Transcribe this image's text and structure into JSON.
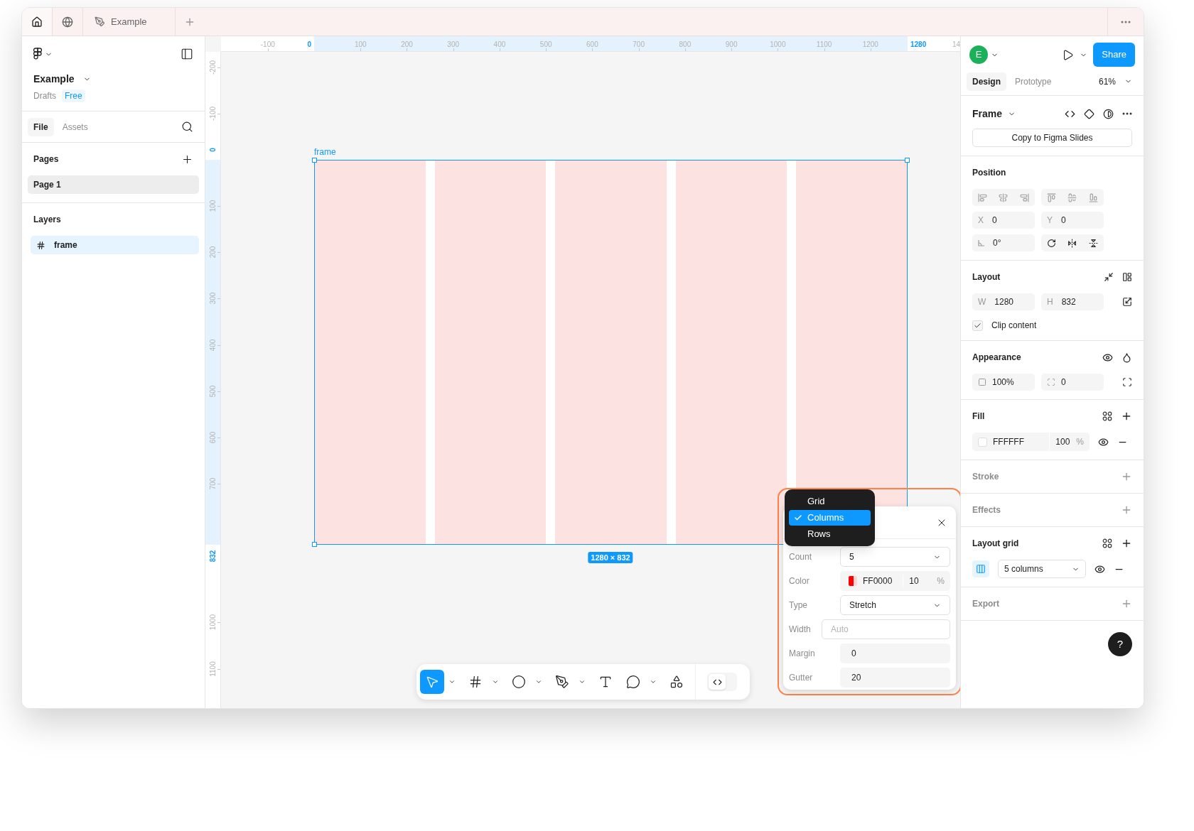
{
  "tab_bar": {
    "tabs": [
      {
        "label": "Example"
      }
    ]
  },
  "file": {
    "name": "Example",
    "location": "Drafts",
    "plan": "Free"
  },
  "left_tabs": [
    {
      "label": "File",
      "selected": true
    },
    {
      "label": "Assets",
      "selected": false
    }
  ],
  "pages": {
    "title": "Pages",
    "items": [
      {
        "label": "Page 1",
        "selected": true
      }
    ]
  },
  "layers": {
    "title": "Layers",
    "items": [
      {
        "label": "frame",
        "selected": true
      }
    ]
  },
  "ruler_top": [
    {
      "label": "-100",
      "kind": "tick"
    },
    {
      "label": "0",
      "kind": "start"
    },
    {
      "label": "100",
      "kind": "tick"
    },
    {
      "label": "200",
      "kind": "tick"
    },
    {
      "label": "300",
      "kind": "tick"
    },
    {
      "label": "400",
      "kind": "tick"
    },
    {
      "label": "500",
      "kind": "tick"
    },
    {
      "label": "600",
      "kind": "tick"
    },
    {
      "label": "700",
      "kind": "tick"
    },
    {
      "label": "800",
      "kind": "tick"
    },
    {
      "label": "900",
      "kind": "tick"
    },
    {
      "label": "1000",
      "kind": "tick"
    },
    {
      "label": "1100",
      "kind": "tick"
    },
    {
      "label": "1200",
      "kind": "tick"
    },
    {
      "label": "1280",
      "kind": "end"
    },
    {
      "label": "14",
      "kind": "cut"
    }
  ],
  "ruler_left": [
    {
      "label": "-200",
      "kind": "tick"
    },
    {
      "label": "-100",
      "kind": "tick"
    },
    {
      "label": "0",
      "kind": "start"
    },
    {
      "label": "100",
      "kind": "tick"
    },
    {
      "label": "200",
      "kind": "tick"
    },
    {
      "label": "300",
      "kind": "tick"
    },
    {
      "label": "400",
      "kind": "tick"
    },
    {
      "label": "500",
      "kind": "tick"
    },
    {
      "label": "600",
      "kind": "tick"
    },
    {
      "label": "700",
      "kind": "tick"
    },
    {
      "label": "832",
      "kind": "end"
    },
    {
      "label": "1000",
      "kind": "tick"
    },
    {
      "label": "1100",
      "kind": "tick"
    }
  ],
  "canvas": {
    "frame_label": "frame",
    "size_badge": "1280 × 832"
  },
  "grid_popup": {
    "menu": [
      {
        "label": "Grid",
        "selected": false
      },
      {
        "label": "Columns",
        "selected": true
      },
      {
        "label": "Rows",
        "selected": false
      }
    ],
    "fields": [
      {
        "label": "Count",
        "kind": "select",
        "value": "5"
      },
      {
        "label": "Color",
        "kind": "color",
        "value": "FF0000",
        "opacity": "10",
        "unit": "%"
      },
      {
        "label": "Type",
        "kind": "select",
        "value": "Stretch"
      },
      {
        "label": "Width",
        "kind": "input",
        "placeholder": "Auto"
      },
      {
        "label": "Margin",
        "kind": "number",
        "value": "0"
      },
      {
        "label": "Gutter",
        "kind": "number",
        "value": "20"
      }
    ]
  },
  "toolbar": {
    "tools": [
      {
        "kind": "move",
        "selected": true,
        "menu": true
      },
      {
        "kind": "frame",
        "selected": false,
        "menu": true
      },
      {
        "kind": "ellipse",
        "selected": false,
        "menu": true
      },
      {
        "kind": "pen",
        "selected": false,
        "menu": true
      },
      {
        "kind": "text",
        "selected": false,
        "menu": false
      },
      {
        "kind": "comment",
        "selected": false,
        "menu": true
      },
      {
        "kind": "actions",
        "selected": false,
        "menu": false
      }
    ],
    "dev_mode": {
      "on": false
    }
  },
  "header": {
    "avatar": "E",
    "share": "Share"
  },
  "right_tabs": [
    {
      "label": "Design",
      "selected": true
    },
    {
      "label": "Prototype",
      "selected": false
    }
  ],
  "zoom": "61%",
  "selection": {
    "title": "Frame",
    "action": "Copy to Figma Slides"
  },
  "position": {
    "title": "Position",
    "x": {
      "label": "X",
      "value": "0"
    },
    "y": {
      "label": "Y",
      "value": "0"
    },
    "rotation": "0°"
  },
  "layout": {
    "title": "Layout",
    "w": {
      "label": "W",
      "value": "1280"
    },
    "h": {
      "label": "H",
      "value": "832"
    },
    "clip": {
      "label": "Clip content",
      "checked": true
    }
  },
  "appearance": {
    "title": "Appearance",
    "opacity": "100%",
    "radius": "0"
  },
  "fill": {
    "title": "Fill",
    "hex": "FFFFFF",
    "opacity": "100",
    "unit": "%"
  },
  "stroke": {
    "title": "Stroke"
  },
  "effects": {
    "title": "Effects"
  },
  "layout_grid": {
    "title": "Layout grid",
    "value": "5 columns"
  },
  "export": {
    "title": "Export"
  },
  "help": "?"
}
